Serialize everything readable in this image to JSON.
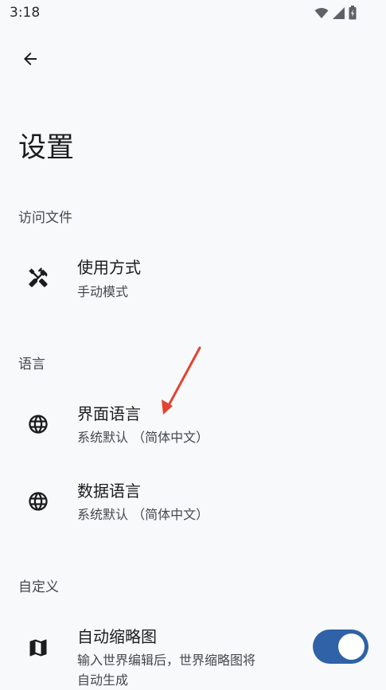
{
  "status_bar": {
    "time": "3:18",
    "icons": [
      "wifi-icon",
      "signal-icon",
      "battery-icon"
    ]
  },
  "toolbar": {
    "back_icon": "arrow-back-icon"
  },
  "page": {
    "title": "设置"
  },
  "sections": [
    {
      "header": "访问文件",
      "items": [
        {
          "icon": "tools-icon",
          "title": "使用方式",
          "summary": "手动模式"
        }
      ]
    },
    {
      "header": "语言",
      "items": [
        {
          "icon": "globe-icon",
          "title": "界面语言",
          "summary": "系统默认 （简体中文）"
        },
        {
          "icon": "globe-icon",
          "title": "数据语言",
          "summary": "系统默认 （简体中文）"
        }
      ]
    },
    {
      "header": "自定义",
      "items": [
        {
          "icon": "map-icon",
          "title": "自动缩略图",
          "summary_line1": "输入世界编辑后，世界缩略图将",
          "summary_line2": "自动生成",
          "toggle_on": true
        }
      ]
    }
  ],
  "colors": {
    "background": "#f8f9fb",
    "accent": "#2f62a6",
    "annotation_arrow": "#e5432f"
  }
}
